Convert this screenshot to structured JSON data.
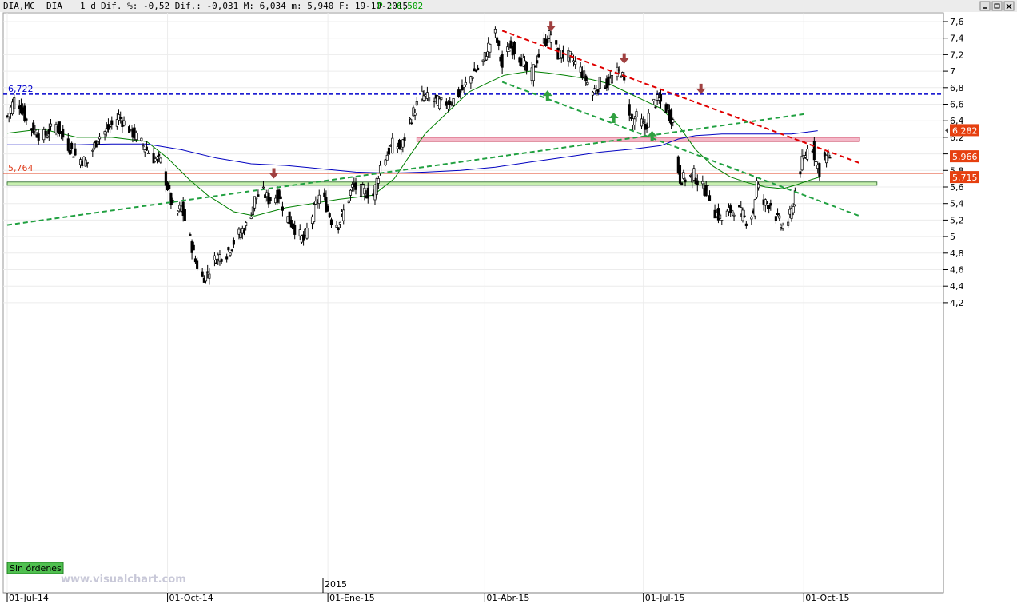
{
  "header": {
    "symbol": "DIA,MC",
    "name": "DIA",
    "period": "1 d",
    "stats": "Dif. %: -0,52 Dif.: -0,031 M: 6,034 m: 5,940 F: 19-10-2015",
    "p_label": "P :",
    "p_value": "6,502"
  },
  "window_buttons": [
    "minimize-icon",
    "maximize-icon",
    "close-icon"
  ],
  "status": {
    "orders": "Sin órdenes",
    "watermark": "www.visualchart.com",
    "year_marker": "2015"
  },
  "colors": {
    "price": "#000000",
    "ma_short": "#008000",
    "ma_long": "#0000c0",
    "resistance": "#e00000",
    "support_channel": "#20a040",
    "level_blue": "#0000cc",
    "level_red": "#e04020",
    "zone_pink": "#f4b8c8",
    "zone_green": "#c8f0b0",
    "badge": "#e64010",
    "arrow_down": "#a04040",
    "arrow_up": "#30a040"
  },
  "chart_data": {
    "type": "candlestick",
    "ylim": [
      4.2,
      7.6
    ],
    "yticks": [
      "7,6",
      "7,4",
      "7,2",
      "7",
      "6,8",
      "6,6",
      "6,4",
      "6,2",
      "6",
      "5,8",
      "5,6",
      "5,4",
      "5,2",
      "5",
      "4,8",
      "4,6",
      "4,4",
      "4,2"
    ],
    "xtick_labels": [
      "01-Jul-14",
      "01-Oct-14",
      "01-Ene-15",
      "01-Abr-15",
      "01-Jul-15",
      "01-Oct-15"
    ],
    "xtick_days": [
      0,
      92,
      184,
      274,
      365,
      457
    ],
    "last_day": 472,
    "close_series": [
      [
        0,
        6.45
      ],
      [
        5,
        6.7
      ],
      [
        12,
        6.35
      ],
      [
        20,
        6.2
      ],
      [
        28,
        6.35
      ],
      [
        35,
        6.1
      ],
      [
        40,
        5.95
      ],
      [
        46,
        5.9
      ],
      [
        52,
        6.2
      ],
      [
        58,
        6.3
      ],
      [
        64,
        6.45
      ],
      [
        70,
        6.3
      ],
      [
        78,
        6.1
      ],
      [
        84,
        5.95
      ],
      [
        88,
        5.9
      ],
      [
        92,
        5.6
      ],
      [
        96,
        5.25
      ],
      [
        100,
        5.35
      ],
      [
        104,
        5.05
      ],
      [
        108,
        4.7
      ],
      [
        112,
        4.5
      ],
      [
        116,
        4.6
      ],
      [
        120,
        4.75
      ],
      [
        126,
        4.8
      ],
      [
        132,
        5.0
      ],
      [
        138,
        5.15
      ],
      [
        142,
        5.45
      ],
      [
        146,
        5.55
      ],
      [
        150,
        5.45
      ],
      [
        156,
        5.5
      ],
      [
        160,
        5.25
      ],
      [
        165,
        5.1
      ],
      [
        170,
        4.95
      ],
      [
        174,
        5.2
      ],
      [
        180,
        5.55
      ],
      [
        186,
        5.2
      ],
      [
        190,
        5.15
      ],
      [
        194,
        5.35
      ],
      [
        198,
        5.6
      ],
      [
        204,
        5.55
      ],
      [
        210,
        5.5
      ],
      [
        214,
        5.85
      ],
      [
        218,
        6.0
      ],
      [
        222,
        6.15
      ],
      [
        226,
        6.05
      ],
      [
        230,
        6.35
      ],
      [
        234,
        6.55
      ],
      [
        238,
        6.7
      ],
      [
        244,
        6.65
      ],
      [
        250,
        6.6
      ],
      [
        256,
        6.65
      ],
      [
        262,
        6.8
      ],
      [
        268,
        7.0
      ],
      [
        272,
        7.05
      ],
      [
        276,
        7.3
      ],
      [
        280,
        7.45
      ],
      [
        284,
        7.05
      ],
      [
        288,
        7.3
      ],
      [
        292,
        7.25
      ],
      [
        296,
        7.1
      ],
      [
        300,
        6.9
      ],
      [
        304,
        7.15
      ],
      [
        308,
        7.35
      ],
      [
        312,
        7.45
      ],
      [
        316,
        7.2
      ],
      [
        320,
        7.2
      ],
      [
        324,
        7.15
      ],
      [
        328,
        7.05
      ],
      [
        332,
        6.9
      ],
      [
        336,
        6.75
      ],
      [
        340,
        6.85
      ],
      [
        344,
        6.85
      ],
      [
        348,
        6.95
      ],
      [
        352,
        7.0
      ],
      [
        354,
        6.85
      ],
      [
        356,
        6.65
      ],
      [
        358,
        6.4
      ],
      [
        362,
        6.45
      ],
      [
        366,
        6.3
      ],
      [
        370,
        6.6
      ],
      [
        374,
        6.65
      ],
      [
        378,
        6.55
      ],
      [
        382,
        6.4
      ],
      [
        384,
        5.9
      ],
      [
        386,
        5.7
      ],
      [
        390,
        5.7
      ],
      [
        394,
        5.75
      ],
      [
        398,
        5.6
      ],
      [
        402,
        5.55
      ],
      [
        406,
        5.3
      ],
      [
        410,
        5.2
      ],
      [
        414,
        5.3
      ],
      [
        418,
        5.35
      ],
      [
        420,
        5.3
      ],
      [
        424,
        5.2
      ],
      [
        428,
        5.3
      ],
      [
        430,
        5.65
      ],
      [
        434,
        5.4
      ],
      [
        438,
        5.4
      ],
      [
        442,
        5.2
      ],
      [
        446,
        5.1
      ],
      [
        450,
        5.3
      ],
      [
        452,
        5.55
      ],
      [
        456,
        5.9
      ],
      [
        458,
        6.0
      ],
      [
        460,
        6.1
      ],
      [
        462,
        6.08
      ],
      [
        464,
        5.9
      ],
      [
        466,
        5.8
      ],
      [
        468,
        5.95
      ],
      [
        472,
        5.97
      ]
    ],
    "ma_short": [
      [
        0,
        6.25
      ],
      [
        20,
        6.3
      ],
      [
        40,
        6.2
      ],
      [
        60,
        6.2
      ],
      [
        80,
        6.15
      ],
      [
        92,
        5.95
      ],
      [
        104,
        5.7
      ],
      [
        115,
        5.5
      ],
      [
        130,
        5.3
      ],
      [
        142,
        5.25
      ],
      [
        160,
        5.35
      ],
      [
        175,
        5.4
      ],
      [
        190,
        5.45
      ],
      [
        210,
        5.5
      ],
      [
        222,
        5.7
      ],
      [
        230,
        5.95
      ],
      [
        240,
        6.25
      ],
      [
        255,
        6.55
      ],
      [
        265,
        6.75
      ],
      [
        275,
        6.85
      ],
      [
        285,
        6.95
      ],
      [
        300,
        7.0
      ],
      [
        310,
        6.98
      ],
      [
        320,
        6.95
      ],
      [
        335,
        6.9
      ],
      [
        345,
        6.85
      ],
      [
        355,
        6.75
      ],
      [
        365,
        6.65
      ],
      [
        375,
        6.55
      ],
      [
        385,
        6.35
      ],
      [
        395,
        6.05
      ],
      [
        405,
        5.85
      ],
      [
        415,
        5.72
      ],
      [
        425,
        5.65
      ],
      [
        435,
        5.6
      ],
      [
        445,
        5.58
      ],
      [
        452,
        5.62
      ],
      [
        460,
        5.68
      ],
      [
        466,
        5.72
      ]
    ],
    "ma_long": [
      [
        0,
        6.11
      ],
      [
        20,
        6.11
      ],
      [
        40,
        6.11
      ],
      [
        60,
        6.12
      ],
      [
        80,
        6.12
      ],
      [
        100,
        6.05
      ],
      [
        120,
        5.95
      ],
      [
        140,
        5.88
      ],
      [
        160,
        5.86
      ],
      [
        180,
        5.82
      ],
      [
        200,
        5.78
      ],
      [
        215,
        5.77
      ],
      [
        225,
        5.77
      ],
      [
        240,
        5.78
      ],
      [
        260,
        5.8
      ],
      [
        280,
        5.84
      ],
      [
        300,
        5.9
      ],
      [
        320,
        5.96
      ],
      [
        340,
        6.02
      ],
      [
        360,
        6.06
      ],
      [
        375,
        6.1
      ],
      [
        385,
        6.18
      ],
      [
        395,
        6.22
      ],
      [
        410,
        6.24
      ],
      [
        430,
        6.24
      ],
      [
        450,
        6.24
      ],
      [
        465,
        6.28
      ]
    ],
    "trend_lines": [
      {
        "from": [
          0,
          5.14
        ],
        "to": [
          457,
          6.48
        ],
        "color": "support_channel"
      },
      {
        "from": [
          284,
          7.49
        ],
        "to": [
          489,
          5.89
        ],
        "color": "resistance"
      },
      {
        "from": [
          284,
          6.87
        ],
        "to": [
          489,
          5.25
        ],
        "color": "support_channel"
      }
    ],
    "levels": [
      {
        "value": 6.722,
        "label": "6,722",
        "color": "level_blue",
        "dashed": true
      },
      {
        "value": 5.764,
        "label": "5,764",
        "color": "level_red",
        "dashed": false
      }
    ],
    "zones": [
      {
        "start_day": 235,
        "end_day": 489,
        "y0": 6.15,
        "y1": 6.2,
        "color": "zone_pink"
      },
      {
        "start_day": 0,
        "end_day": 499,
        "y0": 5.62,
        "y1": 5.66,
        "color": "zone_green"
      }
    ],
    "arrows_down": [
      [
        312,
        7.53
      ],
      [
        354,
        7.14
      ],
      [
        398,
        6.77
      ],
      [
        153,
        5.75
      ]
    ],
    "arrows_up": [
      [
        310,
        6.72
      ],
      [
        348,
        6.45
      ],
      [
        370,
        6.23
      ]
    ],
    "price_badges": [
      {
        "value": 6.282,
        "label": "6,282",
        "pointer": true
      },
      {
        "value": 5.966,
        "label": "5,966",
        "pointer": false
      },
      {
        "value": 5.715,
        "label": "5,715",
        "pointer": false
      }
    ]
  }
}
